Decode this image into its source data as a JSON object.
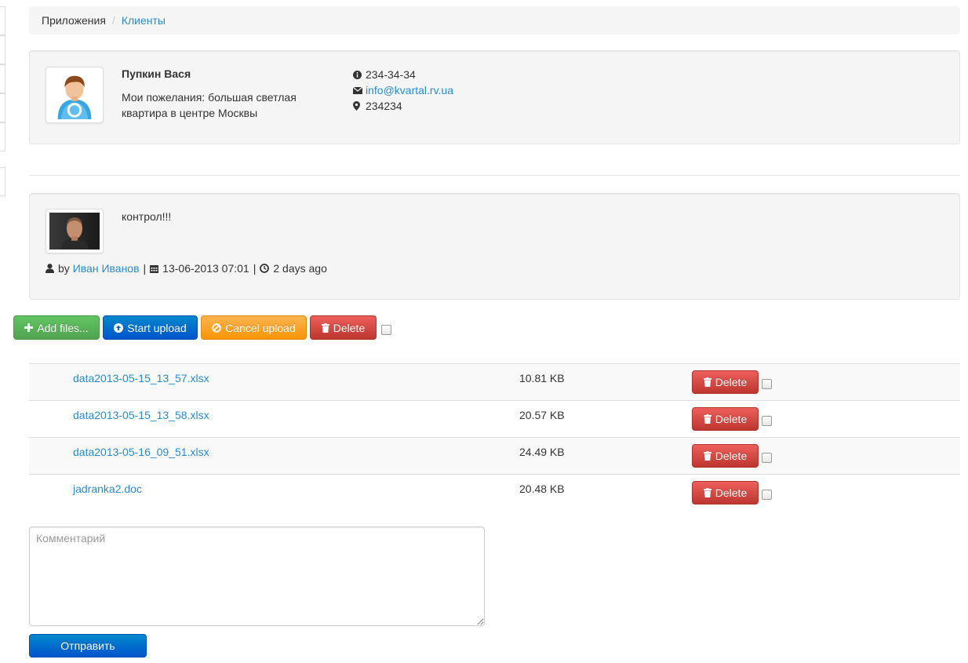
{
  "breadcrumb": {
    "items": [
      {
        "label": "Приложения"
      },
      {
        "label": "Клиенты"
      }
    ],
    "separator": "/"
  },
  "client": {
    "name": "Пупкин Вася",
    "wishes": "Мои пожелания: большая светлая квартира в центре Москвы",
    "phone": "234-34-34",
    "email": "info@kvartal.rv.ua",
    "location": "234234"
  },
  "comment": {
    "text": "контрол!!!",
    "by_label": "by",
    "author": "Иван Иванов",
    "date": "13-06-2013 07:01",
    "ago": "2 days ago",
    "pipe": "|"
  },
  "upload_toolbar": {
    "add_files": "Add files...",
    "start_upload": "Start upload",
    "cancel_upload": "Cancel upload",
    "delete": "Delete"
  },
  "files": [
    {
      "name": "data2013-05-15_13_57.xlsx",
      "size": "10.81 KB",
      "delete_label": "Delete"
    },
    {
      "name": "data2013-05-15_13_58.xlsx",
      "size": "20.57 KB",
      "delete_label": "Delete"
    },
    {
      "name": "data2013-05-16_09_51.xlsx",
      "size": "24.49 KB",
      "delete_label": "Delete"
    },
    {
      "name": "jadranka2.doc",
      "size": "20.48 KB",
      "delete_label": "Delete"
    }
  ],
  "comment_form": {
    "placeholder": "Комментарий",
    "submit": "Отправить"
  },
  "colors": {
    "link": "#2a8bcc",
    "success": "#5bb75b",
    "primary": "#006dcc",
    "warning": "#faa732",
    "danger": "#da4f49"
  }
}
